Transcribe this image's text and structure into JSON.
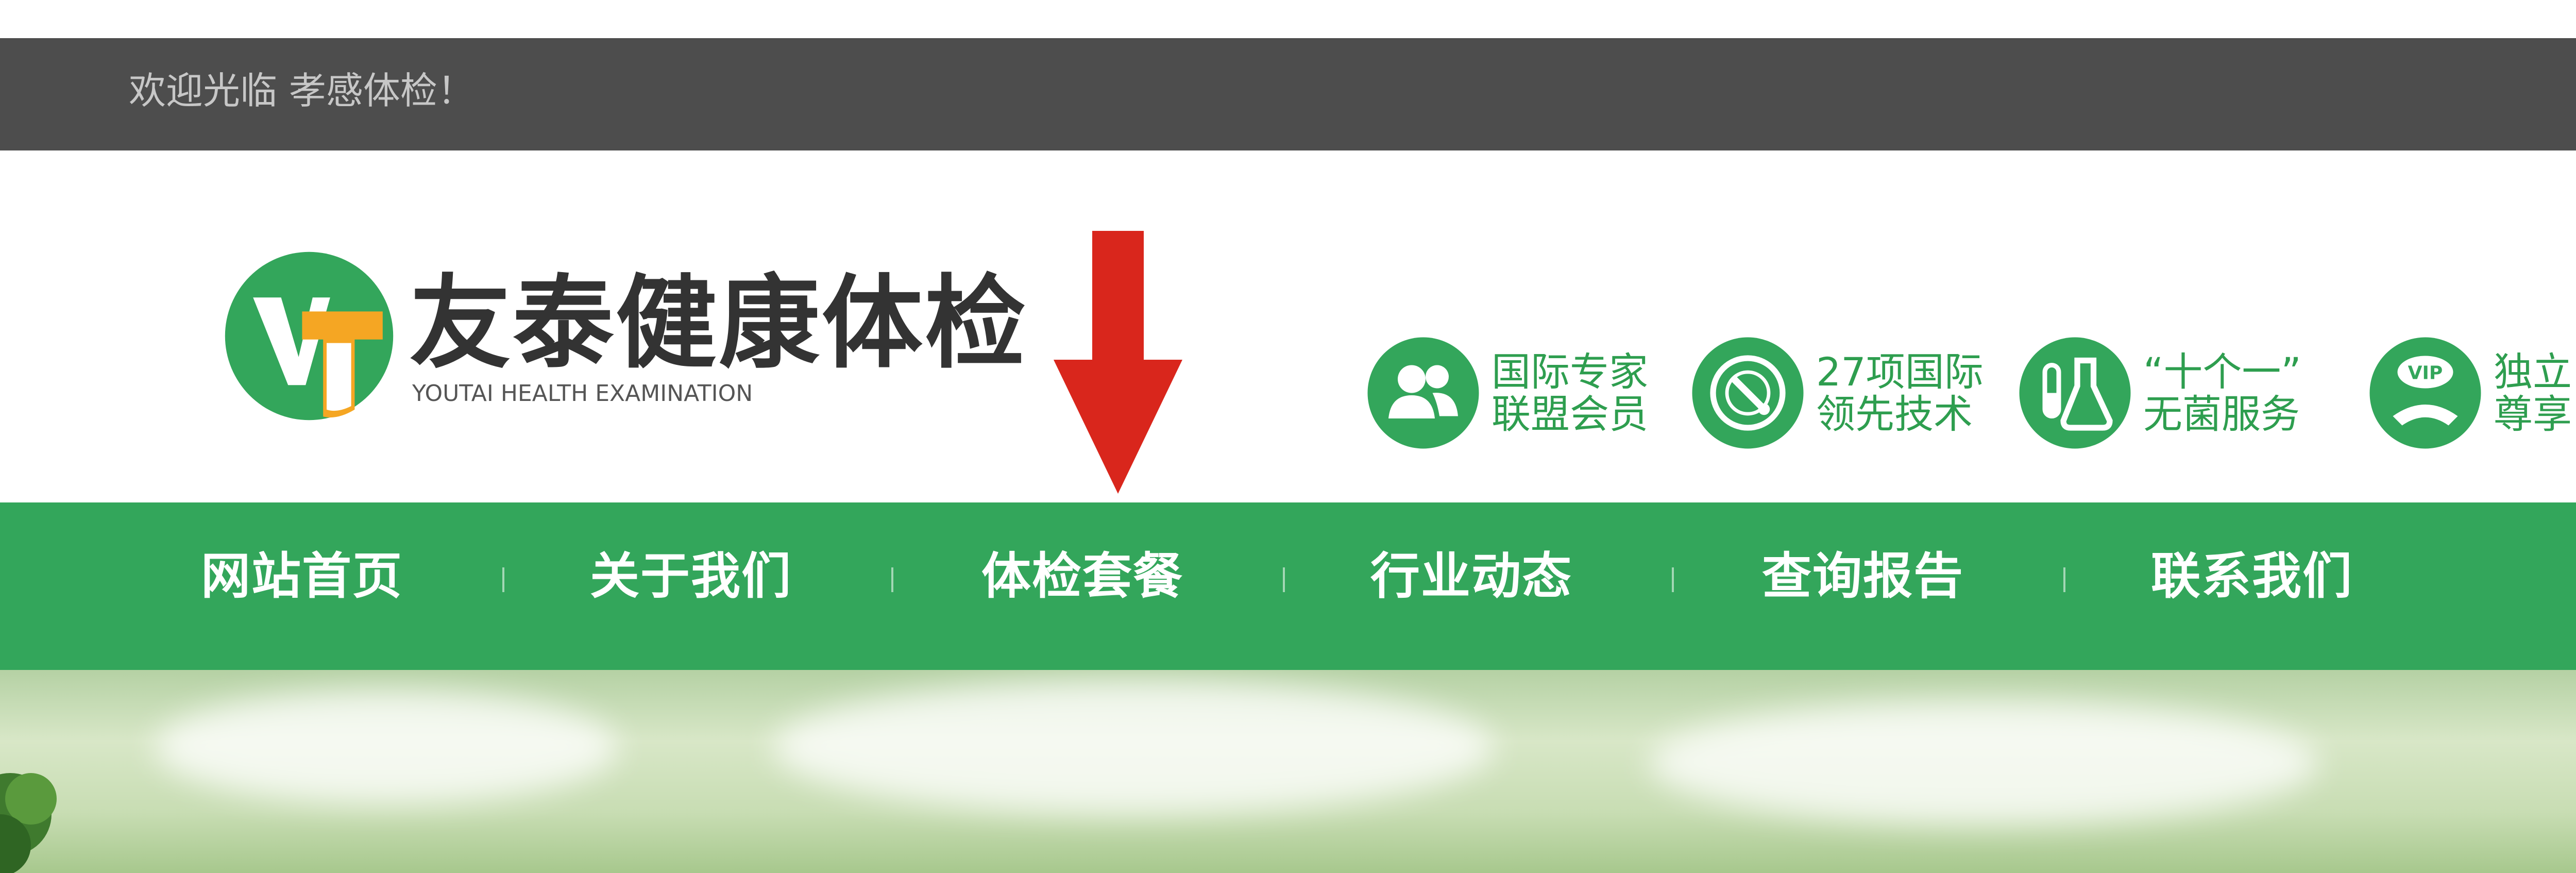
{
  "topbar": {
    "welcome_text": "欢迎光临 孝感体检！"
  },
  "logo": {
    "mark_letters": "VT",
    "name_cn": "友泰健康体检",
    "name_en": "YOUTAI HEALTH EXAMINATION"
  },
  "features": [
    {
      "icon": "people-icon",
      "line1": "国际专家",
      "line2": "联盟会员"
    },
    {
      "icon": "tech-dial-icon",
      "line1": "27项国际",
      "line2": "领先技术"
    },
    {
      "icon": "lab-flask-icon",
      "line1": "“十个一”",
      "line2": "无菌服务"
    },
    {
      "icon": "vip-icon",
      "line1": "独立",
      "line2": "尊享"
    }
  ],
  "nav": {
    "items": [
      {
        "label": "网站首页"
      },
      {
        "label": "关于我们"
      },
      {
        "label": "体检套餐"
      },
      {
        "label": "行业动态"
      },
      {
        "label": "查询报告"
      },
      {
        "label": "联系我们"
      }
    ]
  },
  "annotation": {
    "arrow_icon": "down-arrow-icon",
    "arrow_color": "#d9261c"
  },
  "colors": {
    "topbar": "#4d4d4d",
    "brand_green": "#33a65b",
    "feature_text": "#2e9e4f",
    "logo_orange": "#f5a623"
  }
}
